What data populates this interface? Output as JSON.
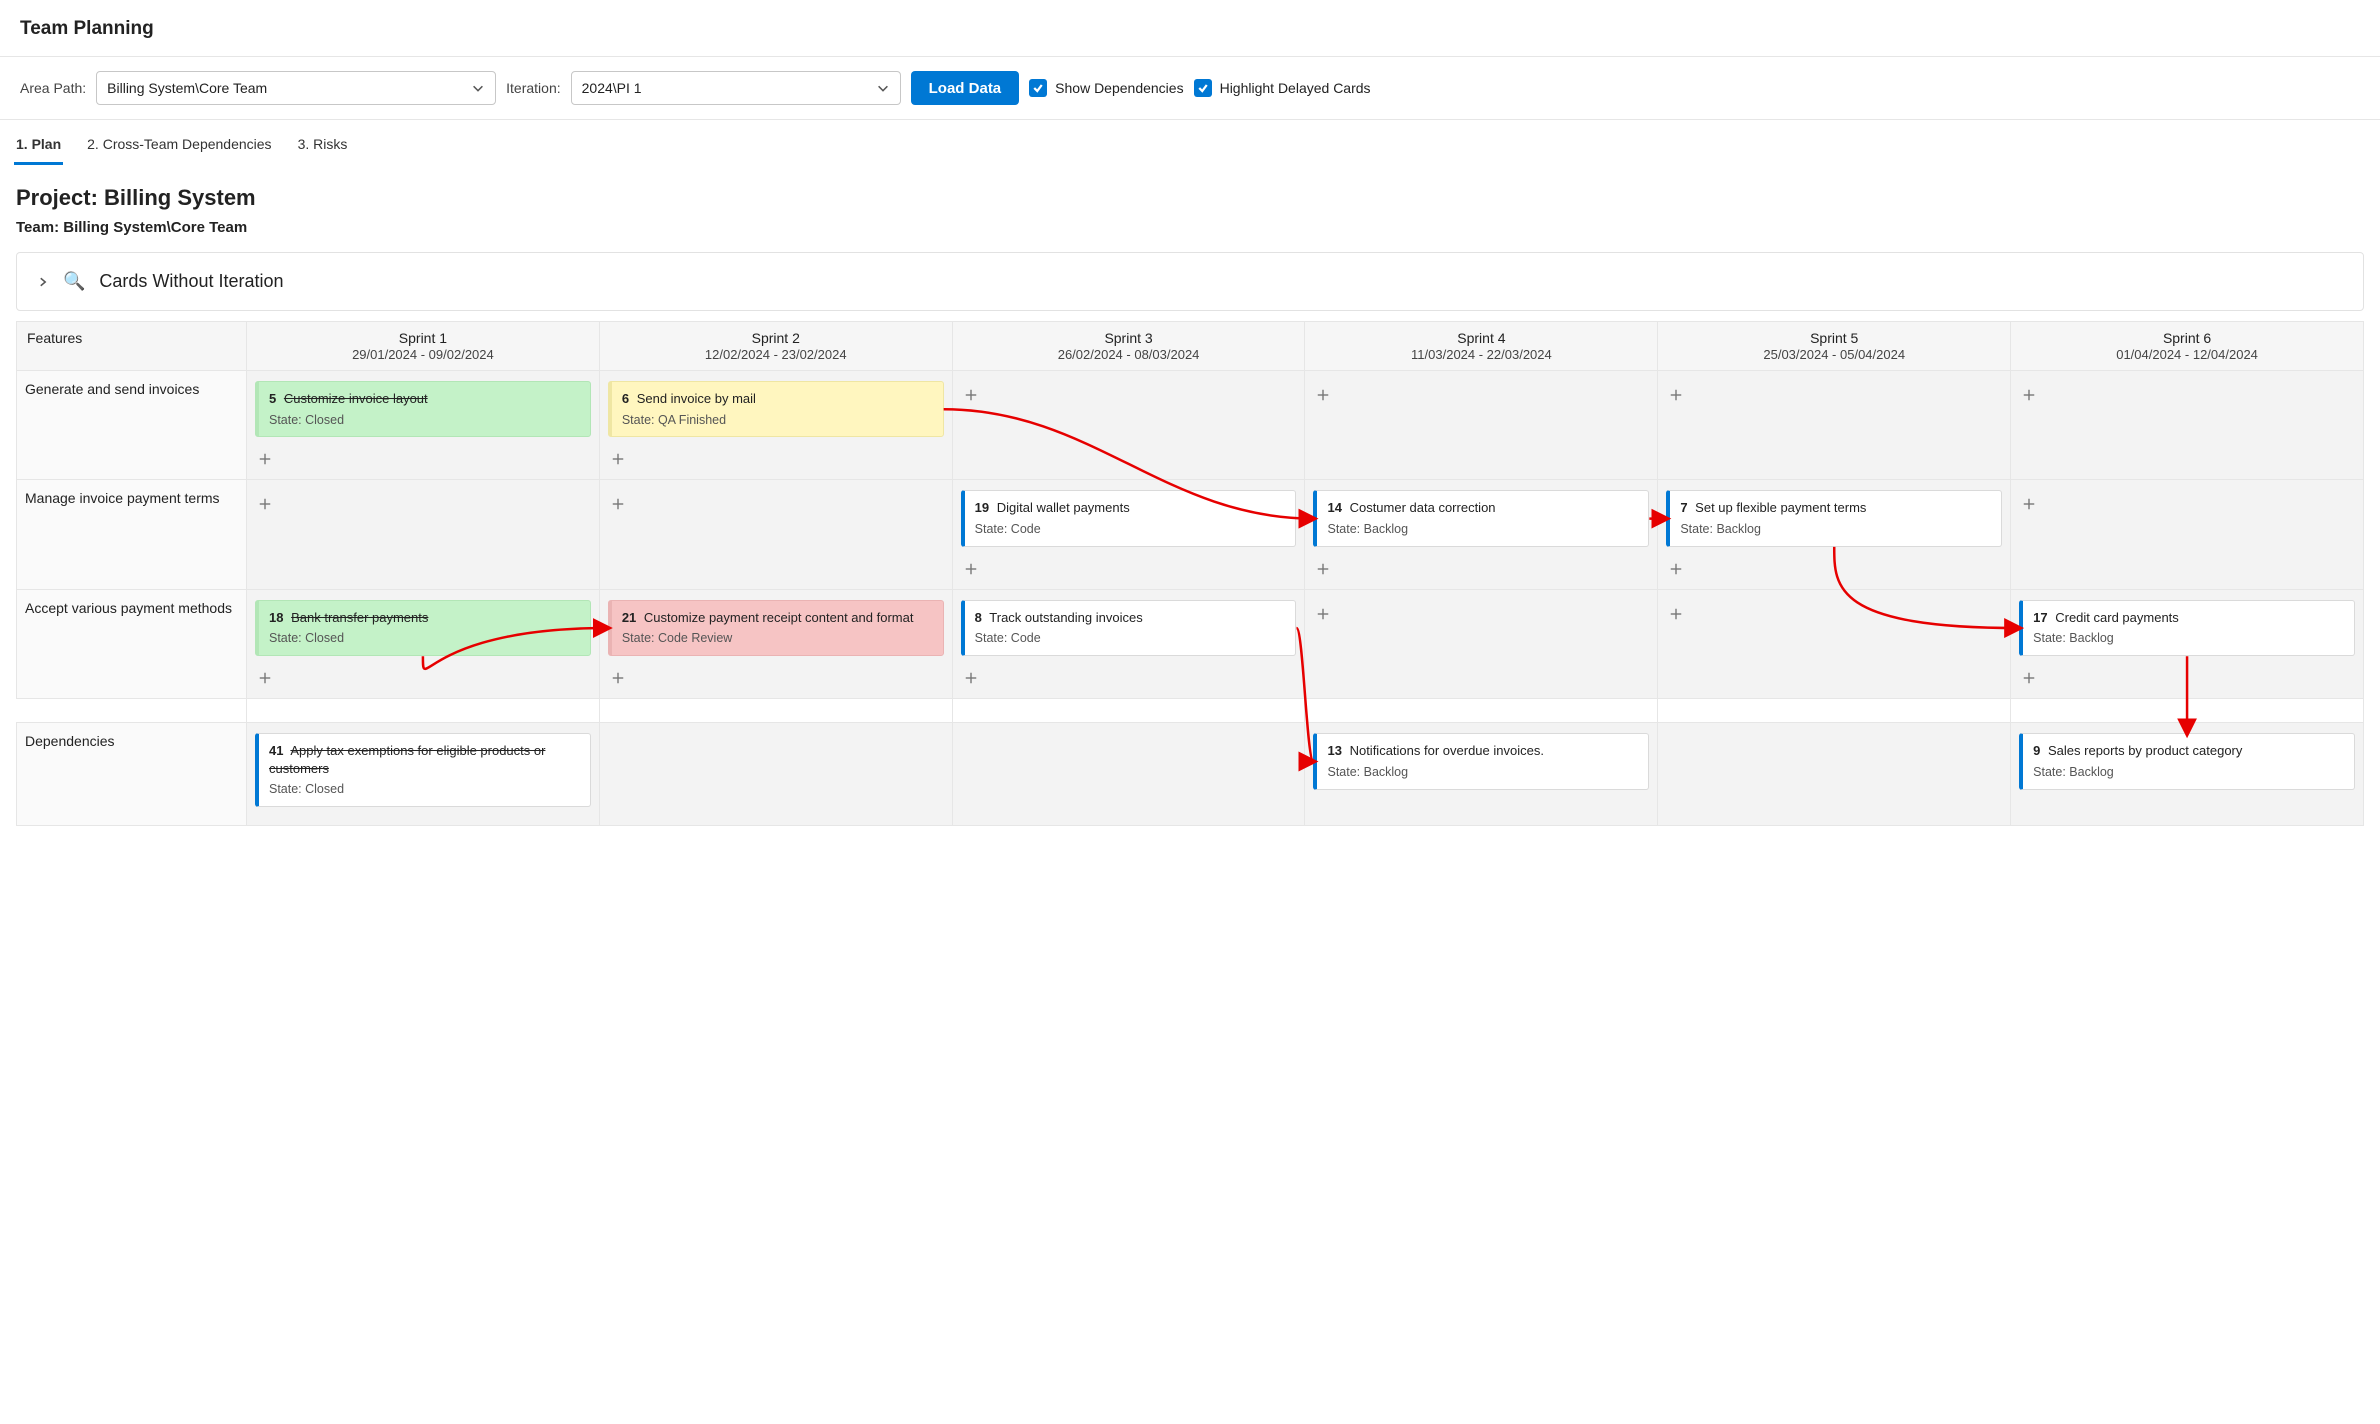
{
  "pageTitle": "Team Planning",
  "toolbar": {
    "areaLabel": "Area Path:",
    "areaValue": "Billing System\\Core Team",
    "iterLabel": "Iteration:",
    "iterValue": "2024\\PI 1",
    "loadButton": "Load Data",
    "chkDeps": "Show Dependencies",
    "chkDelay": "Highlight Delayed Cards"
  },
  "tabs": {
    "plan": "1. Plan",
    "cross": "2. Cross-Team Dependencies",
    "risks": "3. Risks"
  },
  "header": {
    "project": "Project: Billing System",
    "team": "Team: Billing System\\Core Team",
    "cardsWithoutIter": "Cards Without Iteration"
  },
  "columns": {
    "featuresHeader": "Features",
    "sprints": [
      {
        "name": "Sprint 1",
        "dates": "29/01/2024 - 09/02/2024"
      },
      {
        "name": "Sprint 2",
        "dates": "12/02/2024 - 23/02/2024"
      },
      {
        "name": "Sprint 3",
        "dates": "26/02/2024 - 08/03/2024"
      },
      {
        "name": "Sprint 4",
        "dates": "11/03/2024 - 22/03/2024"
      },
      {
        "name": "Sprint 5",
        "dates": "25/03/2024 - 05/04/2024"
      },
      {
        "name": "Sprint 6",
        "dates": "01/04/2024 - 12/04/2024"
      }
    ]
  },
  "features": {
    "f1": "Generate and send invoices",
    "f2": "Manage invoice payment terms",
    "f3": "Accept various payment methods",
    "f4": "Dependencies"
  },
  "cards": {
    "c5": {
      "id": "5",
      "title": "Customize invoice layout",
      "state": "State: Closed",
      "strike": true
    },
    "c6": {
      "id": "6",
      "title": "Send invoice by mail",
      "state": "State: QA Finished"
    },
    "c19": {
      "id": "19",
      "title": "Digital wallet payments",
      "state": "State: Code"
    },
    "c14": {
      "id": "14",
      "title": "Costumer data correction",
      "state": "State: Backlog"
    },
    "c7": {
      "id": "7",
      "title": "Set up flexible payment terms",
      "state": "State: Backlog"
    },
    "c18": {
      "id": "18",
      "title": "Bank transfer payments",
      "state": "State: Closed",
      "strike": true
    },
    "c21": {
      "id": "21",
      "title": "Customize payment receipt content and format",
      "state": "State: Code Review"
    },
    "c8": {
      "id": "8",
      "title": "Track outstanding invoices",
      "state": "State: Code"
    },
    "c17": {
      "id": "17",
      "title": "Credit card payments",
      "state": "State: Backlog"
    },
    "c41": {
      "id": "41",
      "title": "Apply tax exemptions for eligible products or customers",
      "state": "State: Closed",
      "strike": true
    },
    "c13": {
      "id": "13",
      "title": "Notifications for overdue invoices.",
      "state": "State: Backlog"
    },
    "c9": {
      "id": "9",
      "title": "Sales reports by product category",
      "state": "State: Backlog"
    }
  },
  "arrows": [
    {
      "from": "card-6",
      "to": "card-14",
      "fromSide": "right",
      "toSide": "left"
    },
    {
      "from": "card-14",
      "to": "card-7",
      "fromSide": "right",
      "toSide": "left"
    },
    {
      "from": "card-7",
      "to": "card-17",
      "fromSide": "bottom",
      "toSide": "left"
    },
    {
      "from": "card-18",
      "to": "card-21",
      "fromSide": "bottom",
      "toSide": "left",
      "startYOffset": 0
    },
    {
      "from": "card-8",
      "to": "card-13",
      "fromSide": "right",
      "toSide": "left"
    },
    {
      "from": "card-17",
      "to": "card-9",
      "fromSide": "bottom",
      "toSide": "top"
    }
  ]
}
